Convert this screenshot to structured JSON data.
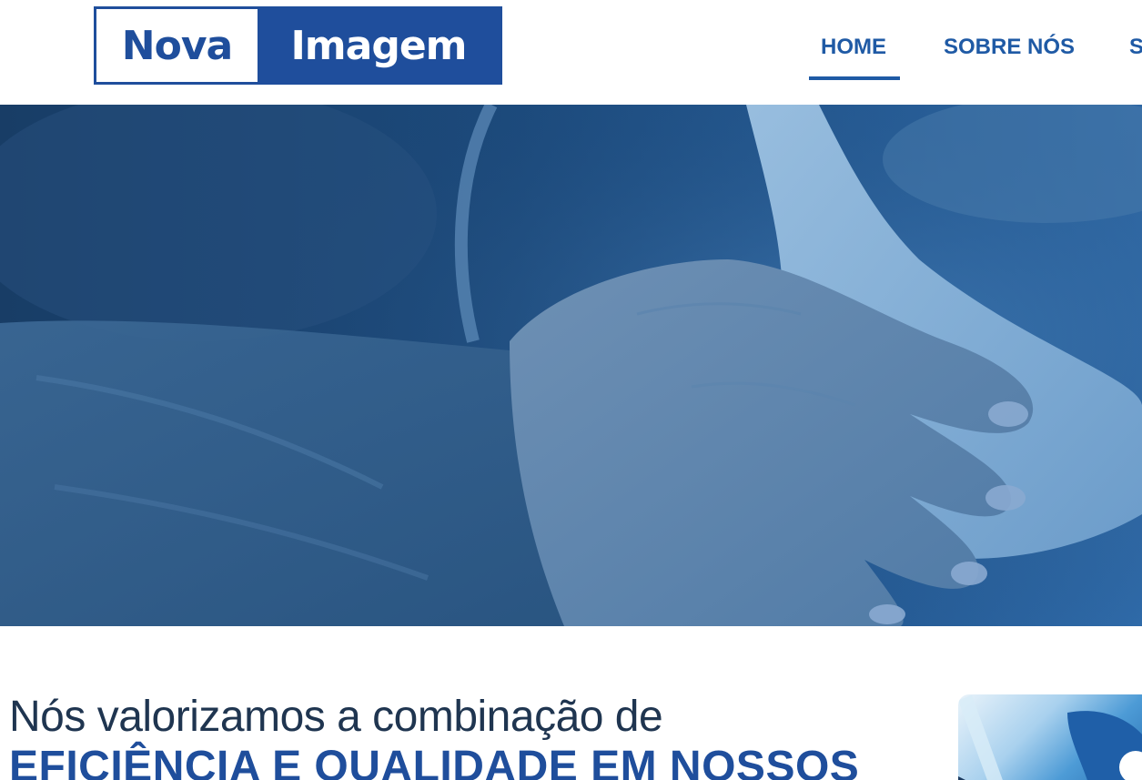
{
  "logo": {
    "part1": "Nova",
    "part2": "Imagem"
  },
  "nav": {
    "items": [
      {
        "label": "HOME",
        "active": true
      },
      {
        "label": "SOBRE NÓS",
        "active": false
      },
      {
        "label": "S",
        "active": false
      }
    ]
  },
  "hero": {
    "image": "ultrasound-exam-photo"
  },
  "intro": {
    "line1": "Nós valorizamos a combinação de",
    "line2": "EFICIÊNCIA E QUALIDADE EM NOSSOS"
  },
  "colors": {
    "brand": "#1f4e9c",
    "nav": "#1f5aa5",
    "hero_overlay": "#1c4a7c"
  }
}
